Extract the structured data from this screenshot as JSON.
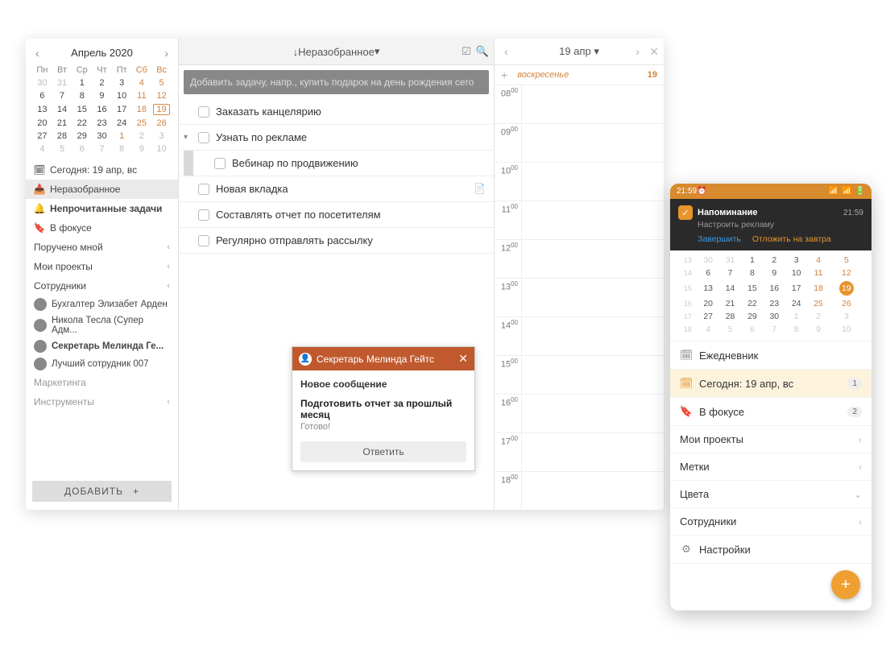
{
  "calendar": {
    "title": "Апрель 2020",
    "dow": [
      "Пн",
      "Вт",
      "Ср",
      "Чт",
      "Пт",
      "Сб",
      "Вс"
    ],
    "weeks": [
      [
        {
          "d": "30",
          "g": 1
        },
        {
          "d": "31",
          "g": 1
        },
        {
          "d": "1"
        },
        {
          "d": "2"
        },
        {
          "d": "3"
        },
        {
          "d": "4",
          "w": 1
        },
        {
          "d": "5",
          "w": 1
        }
      ],
      [
        {
          "d": "6"
        },
        {
          "d": "7"
        },
        {
          "d": "8"
        },
        {
          "d": "9"
        },
        {
          "d": "10"
        },
        {
          "d": "11",
          "w": 1
        },
        {
          "d": "12",
          "w": 1
        }
      ],
      [
        {
          "d": "13"
        },
        {
          "d": "14"
        },
        {
          "d": "15"
        },
        {
          "d": "16"
        },
        {
          "d": "17"
        },
        {
          "d": "18",
          "w": 1
        },
        {
          "d": "19",
          "w": 1,
          "t": 1
        }
      ],
      [
        {
          "d": "20"
        },
        {
          "d": "21"
        },
        {
          "d": "22"
        },
        {
          "d": "23"
        },
        {
          "d": "24"
        },
        {
          "d": "25",
          "w": 1
        },
        {
          "d": "26",
          "w": 1
        }
      ],
      [
        {
          "d": "27"
        },
        {
          "d": "28"
        },
        {
          "d": "29"
        },
        {
          "d": "30"
        },
        {
          "d": "1",
          "w": 1
        },
        {
          "d": "2",
          "g": 1
        },
        {
          "d": "3",
          "g": 1
        }
      ],
      [
        {
          "d": "4",
          "g": 1
        },
        {
          "d": "5",
          "g": 1
        },
        {
          "d": "6",
          "g": 1
        },
        {
          "d": "7",
          "g": 1
        },
        {
          "d": "8",
          "g": 1
        },
        {
          "d": "9",
          "g": 1
        },
        {
          "d": "10",
          "g": 1
        }
      ]
    ]
  },
  "sidebar": {
    "today": "Сегодня: 19 апр, вс",
    "inbox": "Неразобранное",
    "unread": "Непрочитанные задачи",
    "focus": "В фокусе",
    "assigned": "Поручено мной",
    "projects": "Мои проекты",
    "staff": "Сотрудники",
    "users": [
      "Бухгалтер Элизабет Арден",
      "Никола Тесла (Супер Адм...",
      "Секретарь Мелинда Ге...",
      "Лучший сотрудник 007"
    ],
    "marketing": "Маркетинга",
    "tools": "Инструменты",
    "add": "ДОБАВИТЬ"
  },
  "tasks": {
    "header": "Неразобранное",
    "placeholder": "Добавить задачу, напр., купить подарок на день рождения сего",
    "items": [
      "Заказать канцелярию",
      "Узнать по рекламе",
      "Вебинар по продвижению",
      "Новая вкладка",
      "Составлять отчет по посетителям",
      "Регулярно отправлять рассылку"
    ]
  },
  "chat": {
    "from": "Секретарь Мелинда Гейтс",
    "new_msg": "Новое сообщение",
    "subject": "Подготовить отчет за прошлый месяц",
    "status": "Готово!",
    "reply": "Ответить"
  },
  "day": {
    "title": "19 апр",
    "dow": "воскресенье",
    "num": "19",
    "hours": [
      "08",
      "09",
      "10",
      "11",
      "12",
      "13",
      "14",
      "15",
      "16",
      "17",
      "18"
    ]
  },
  "mobile": {
    "time": "21:59",
    "notif": {
      "title": "Напоминание",
      "sub": "Настроить рекламу",
      "t": "21:59",
      "a1": "Завершить",
      "a2": "Отложить на завтра"
    },
    "cal_weeks": [
      [
        {
          "wn": "13"
        },
        {
          "d": "30",
          "g": 1
        },
        {
          "d": "31",
          "g": 1
        },
        {
          "d": "1"
        },
        {
          "d": "2"
        },
        {
          "d": "3"
        },
        {
          "d": "4",
          "w": 1
        },
        {
          "d": "5",
          "w": 1
        }
      ],
      [
        {
          "wn": "14"
        },
        {
          "d": "6"
        },
        {
          "d": "7"
        },
        {
          "d": "8"
        },
        {
          "d": "9"
        },
        {
          "d": "10"
        },
        {
          "d": "11",
          "w": 1
        },
        {
          "d": "12",
          "w": 1
        }
      ],
      [
        {
          "wn": "15"
        },
        {
          "d": "13"
        },
        {
          "d": "14"
        },
        {
          "d": "15"
        },
        {
          "d": "16"
        },
        {
          "d": "17"
        },
        {
          "d": "18",
          "w": 1
        },
        {
          "d": "19",
          "w": 1,
          "t": 1
        }
      ],
      [
        {
          "wn": "16"
        },
        {
          "d": "20"
        },
        {
          "d": "21"
        },
        {
          "d": "22"
        },
        {
          "d": "23"
        },
        {
          "d": "24"
        },
        {
          "d": "25",
          "w": 1
        },
        {
          "d": "26",
          "w": 1
        }
      ],
      [
        {
          "wn": "17"
        },
        {
          "d": "27"
        },
        {
          "d": "28"
        },
        {
          "d": "29"
        },
        {
          "d": "30"
        },
        {
          "d": "1",
          "g": 1
        },
        {
          "d": "2",
          "g": 1
        },
        {
          "d": "3",
          "g": 1
        }
      ],
      [
        {
          "wn": "18"
        },
        {
          "d": "4",
          "g": 1
        },
        {
          "d": "5",
          "g": 1
        },
        {
          "d": "6",
          "g": 1
        },
        {
          "d": "7",
          "g": 1
        },
        {
          "d": "8",
          "g": 1
        },
        {
          "d": "9",
          "g": 1
        },
        {
          "d": "10",
          "g": 1
        }
      ]
    ],
    "items": {
      "diary": "Ежедневник",
      "today": "Сегодня: 19 апр, вс",
      "focus": "В фокусе",
      "projects": "Мои проекты",
      "tags": "Метки",
      "colors": "Цвета",
      "staff": "Сотрудники",
      "settings": "Настройки"
    },
    "badges": {
      "today": "1",
      "focus": "2"
    }
  }
}
